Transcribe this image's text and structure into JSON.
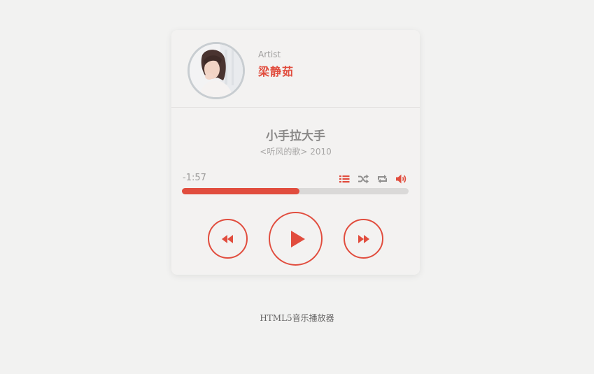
{
  "player": {
    "artist_label": "Artist",
    "artist_name": "梁静茹",
    "song_title": "小手拉大手",
    "album": "<听风的歌> 2010",
    "time_remaining": "-1:57",
    "progress": 0.52,
    "controls": [
      "playlist-icon",
      "shuffle-icon",
      "repeat-icon",
      "volume-icon"
    ],
    "buttons": [
      "rewind",
      "play",
      "fast-forward"
    ]
  },
  "colors": {
    "accent": "#e14d3e",
    "background": "#f2f2f1",
    "track": "#dad9d8",
    "title_text": "#8a8988"
  },
  "footer": {
    "text": "HTML5音乐播放器"
  }
}
